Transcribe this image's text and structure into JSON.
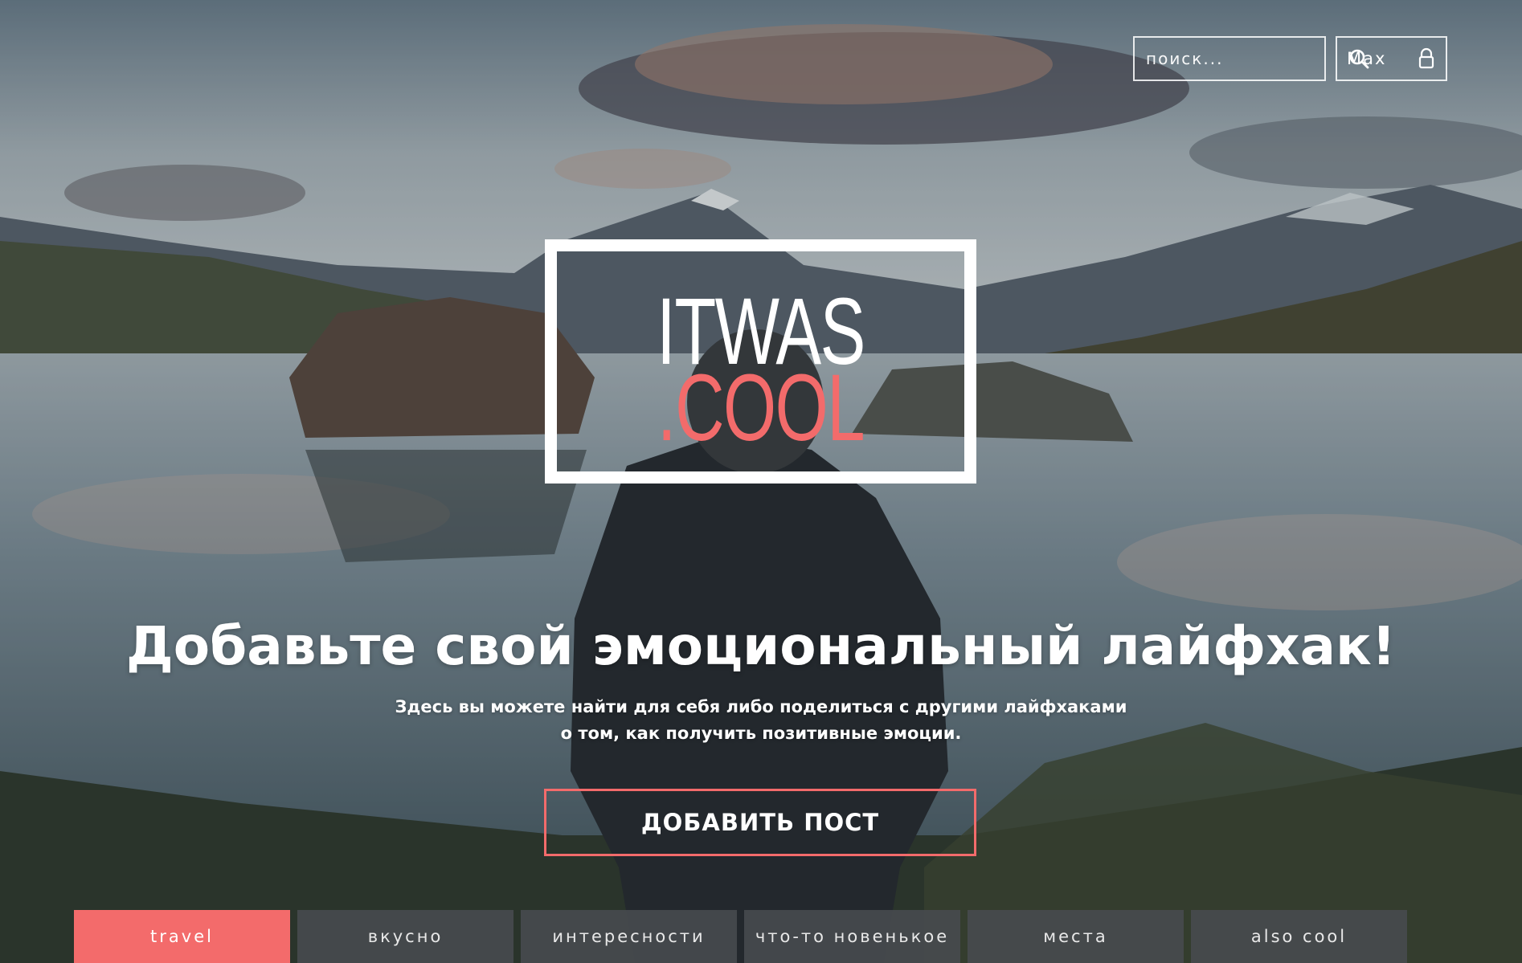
{
  "header": {
    "search_placeholder": "поиск...",
    "user_name": "Max"
  },
  "logo": {
    "line1": "ITWAS",
    "line2": ".COOL"
  },
  "hero": {
    "headline": "Добавьте свой эмоциональный лайфхак!",
    "subtitle_line1": "Здесь вы можете найти для себя либо поделиться с другими лайфхаками",
    "subtitle_line2": "о том, как получить позитивные эмоции.",
    "cta_label": "ДОБАВИТЬ ПОСТ"
  },
  "tabs": [
    {
      "label": "travel",
      "active": true
    },
    {
      "label": "вкусно",
      "active": false
    },
    {
      "label": "интересности",
      "active": false
    },
    {
      "label": "что-то новенькое",
      "active": false
    },
    {
      "label": "места",
      "active": false
    },
    {
      "label": "also cool",
      "active": false
    }
  ],
  "colors": {
    "accent": "#f36b6b",
    "tab_bg": "#464a4e",
    "text": "#ffffff"
  },
  "icons": {
    "search": "search-icon",
    "lock": "lock-icon"
  }
}
